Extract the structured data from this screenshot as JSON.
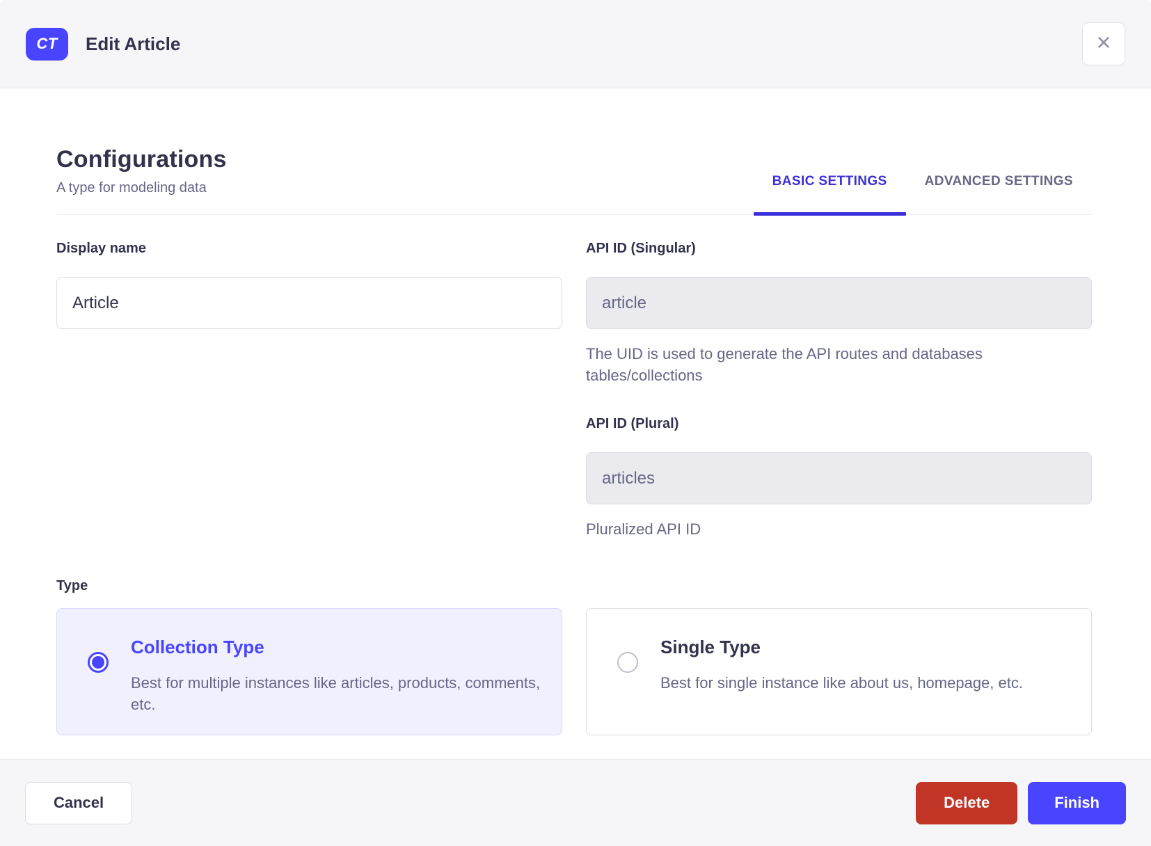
{
  "modal": {
    "badge": "CT",
    "title": "Edit Article",
    "close_icon": "×"
  },
  "configurations": {
    "heading": "Configurations",
    "subheading": "A type for modeling data"
  },
  "tabs": [
    {
      "label": "BASIC SETTINGS",
      "active": true
    },
    {
      "label": "ADVANCED SETTINGS",
      "active": false
    }
  ],
  "form": {
    "display_name": {
      "label": "Display name",
      "value": "Article"
    },
    "api_id_singular": {
      "label": "API ID (Singular)",
      "value": "article",
      "hint": "The UID is used to generate the API routes and databases tables/collections"
    },
    "api_id_plural": {
      "label": "API ID (Plural)",
      "value": "articles",
      "hint": "Pluralized API ID"
    },
    "type": {
      "label": "Type",
      "options": [
        {
          "title": "Collection Type",
          "description": "Best for multiple instances like articles, products, comments, etc.",
          "selected": true
        },
        {
          "title": "Single Type",
          "description": "Best for single instance like about us, homepage, etc.",
          "selected": false
        }
      ]
    }
  },
  "footer": {
    "cancel_label": "Cancel",
    "delete_label": "Delete",
    "finish_label": "Finish"
  },
  "colors": {
    "primary": "#4945ff",
    "tab_accent": "#3b2fd9",
    "danger": "#c13527",
    "text_dark": "#32324d",
    "text_muted": "#666687",
    "surface_neutral": "#f6f6f9",
    "border_neutral": "#dcdce4",
    "disabled_bg": "#eaeaef",
    "selected_card_bg": "#f0f0ff"
  }
}
